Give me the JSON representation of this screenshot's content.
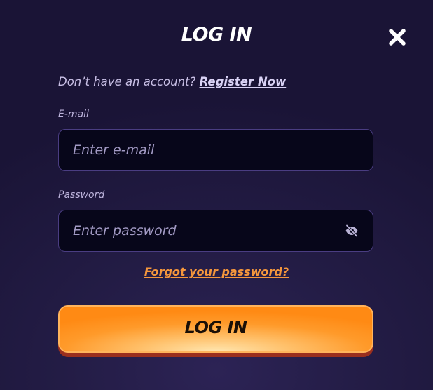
{
  "modal": {
    "title": "LOG IN",
    "close_icon": "close-icon"
  },
  "register": {
    "prompt": "Don’t have an account?",
    "link": "Register Now"
  },
  "email": {
    "label": "E-mail",
    "placeholder": "Enter e-mail",
    "value": ""
  },
  "password": {
    "label": "Password",
    "placeholder": "Enter password",
    "value": "",
    "toggle_icon": "eye-slash-icon"
  },
  "forgot": {
    "label": "Forgot your password?"
  },
  "submit": {
    "label": "LOG IN"
  },
  "colors": {
    "background": "#1f1840",
    "accent_orange": "#ff9a2a",
    "link_orange": "#f5973c",
    "input_bg": "#07061a",
    "input_border": "#4a3d82"
  }
}
